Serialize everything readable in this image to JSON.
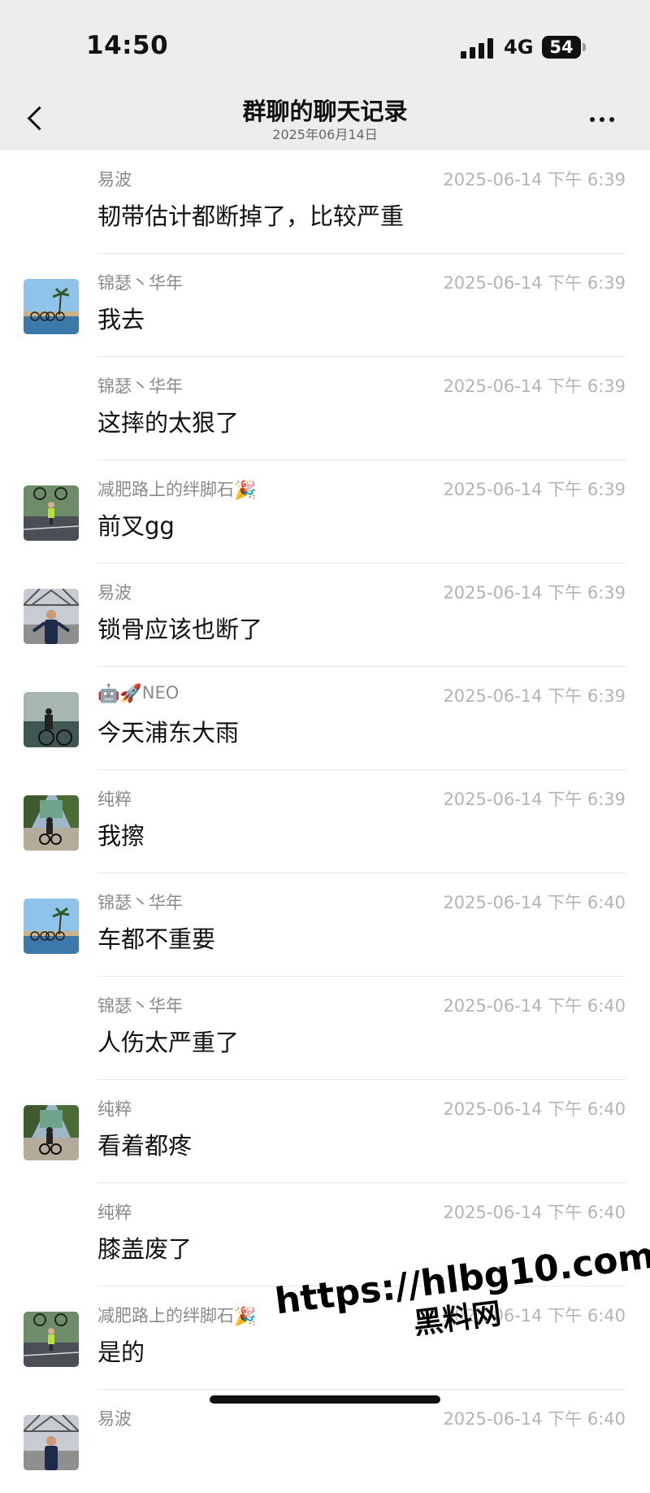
{
  "status_bar": {
    "time": "14:50",
    "network": "4G",
    "battery": "54"
  },
  "nav": {
    "title": "群聊的聊天记录",
    "subtitle": "2025年06月14日"
  },
  "messages": [
    {
      "sender": "易波",
      "time": "2025-06-14 下午 6:39",
      "text": "韧带估计都断掉了，比较严重",
      "avatar": ""
    },
    {
      "sender": "锦瑟丶华年",
      "time": "2025-06-14 下午 6:39",
      "text": "我去",
      "avatar": "beach-bikes"
    },
    {
      "sender": "锦瑟丶华年",
      "time": "2025-06-14 下午 6:39",
      "text": "这摔的太狠了",
      "avatar": ""
    },
    {
      "sender": "减肥路上的绊脚石",
      "sender_emoji": "🎉",
      "time": "2025-06-14 下午 6:39",
      "text": "前叉gg",
      "avatar": "road-bike-lift"
    },
    {
      "sender": "易波",
      "time": "2025-06-14 下午 6:39",
      "text": "锁骨应该也断了",
      "avatar": "bridge-person"
    },
    {
      "sender_emoji": "🤖🚀",
      "sender": "NEO",
      "time": "2025-06-14 下午 6:39",
      "text": "今天浦东大雨",
      "avatar": "seaside-rider"
    },
    {
      "sender": "纯粹",
      "time": "2025-06-14 下午 6:39",
      "text": "我擦",
      "avatar": "park-cyclist"
    },
    {
      "sender": "锦瑟丶华年",
      "time": "2025-06-14 下午 6:40",
      "text": "车都不重要",
      "avatar": "beach-bikes"
    },
    {
      "sender": "锦瑟丶华年",
      "time": "2025-06-14 下午 6:40",
      "text": "人伤太严重了",
      "avatar": ""
    },
    {
      "sender": "纯粹",
      "time": "2025-06-14 下午 6:40",
      "text": "看着都疼",
      "avatar": "park-cyclist"
    },
    {
      "sender": "纯粹",
      "time": "2025-06-14 下午 6:40",
      "text": "膝盖废了",
      "avatar": ""
    },
    {
      "sender": "减肥路上的绊脚石",
      "sender_emoji": "🎉",
      "time": "2025-06-14 下午 6:40",
      "text": "是的",
      "avatar": "road-bike-lift"
    },
    {
      "sender": "易波",
      "time": "2025-06-14 下午 6:40",
      "text": "",
      "avatar": "bridge-person"
    }
  ],
  "watermark": {
    "url": "https://hlbg10.com",
    "label": "黑料网"
  },
  "colors": {
    "header_bg": "#ededed",
    "timestamp": "#b4b4b4",
    "sender": "#8a8a8a"
  }
}
